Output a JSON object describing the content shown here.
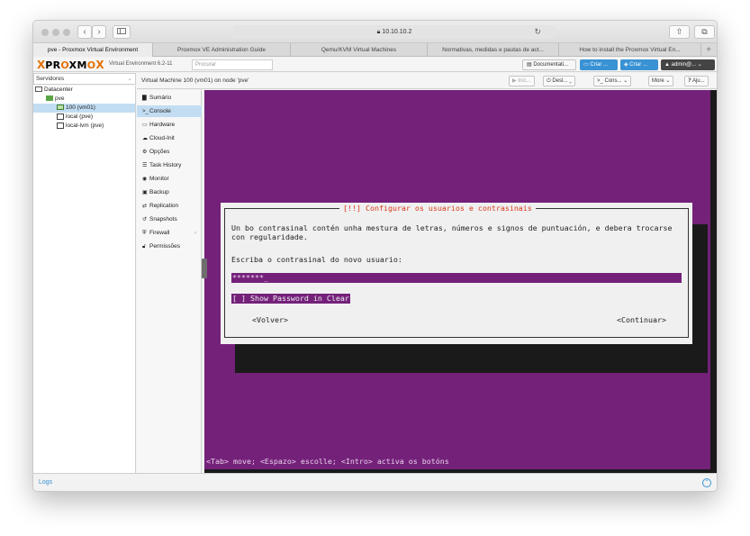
{
  "browser": {
    "url": "10.10.10.2",
    "tabs": [
      {
        "label": "pve - Proxmox Virtual Environment",
        "active": true
      },
      {
        "label": "Proxmox VE Administration Guide",
        "active": false
      },
      {
        "label": "Qemu/KVM Virtual Machines",
        "active": false
      },
      {
        "label": "Normativas, medidas e pautas de act...",
        "active": false
      },
      {
        "label": "How to install the Proxmox Virtual En...",
        "active": false
      }
    ],
    "new_tab": "+"
  },
  "header": {
    "logo_text_a": "PR",
    "logo_text_o": "O",
    "logo_text_b": "XM",
    "logo_text_o2": "O",
    "logo_text_x": "X",
    "environment": "Virtual Environment 6.2-11",
    "search_placeholder": "Procurar",
    "documentation": "Documentati...",
    "create_vm": "Criar ...",
    "create_ct": "Criar ...",
    "user": "admin@..."
  },
  "server_view": {
    "label": "Servidores"
  },
  "tree": {
    "datacenter": "Datacenter",
    "node": "pve",
    "vm": "100 (vm01)",
    "storage1": "local (pve)",
    "storage2": "local-lvm (pve)"
  },
  "content": {
    "title": "Virtual Machine 100 (vm01) on node 'pve'",
    "buttons": {
      "start": "Inic...",
      "shutdown": "Desl...",
      "console": "Cons...",
      "more": "More",
      "help": "Aju..."
    }
  },
  "vm_menu": [
    {
      "icon": "summary",
      "label": "Sumário"
    },
    {
      "icon": "console",
      "label": "Console",
      "selected": true
    },
    {
      "icon": "hardware",
      "label": "Hardware"
    },
    {
      "icon": "cloud",
      "label": "Cloud-Init"
    },
    {
      "icon": "options",
      "label": "Opções"
    },
    {
      "icon": "task-history",
      "label": "Task History"
    },
    {
      "icon": "monitor",
      "label": "Monitor"
    },
    {
      "icon": "backup",
      "label": "Backup"
    },
    {
      "icon": "replication",
      "label": "Replication"
    },
    {
      "icon": "snapshots",
      "label": "Snapshots"
    },
    {
      "icon": "firewall",
      "label": "Firewall"
    },
    {
      "icon": "permissions",
      "label": "Permissões"
    }
  ],
  "dialog": {
    "title": "[!!] Configurar os usuarios e contrasinais",
    "text": "Un bo contrasinal contén unha mestura de letras, números e signos de puntuación, e debera trocarse con regularidade.",
    "prompt": "Escriba o contrasinal do novo usuario:",
    "password_value": "*******_",
    "show_password": "[ ] Show Password in Clear",
    "back": "<Volver>",
    "continue": "<Continuar>"
  },
  "hint": "<Tab> move; <Espazo> escolle; <Intro> activa os botóns",
  "footer": {
    "logs": "Logs"
  },
  "colors": {
    "console_bg": "#74217a",
    "accent": "#3892d4",
    "brand": "#e57000"
  }
}
